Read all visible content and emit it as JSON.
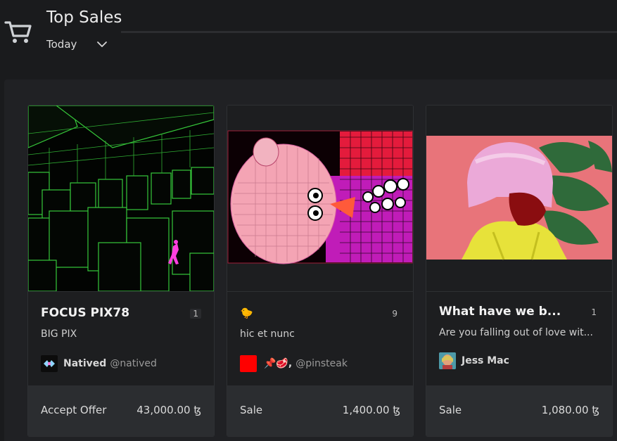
{
  "header": {
    "title": "Top Sales",
    "filter_label": "Today"
  },
  "cards": [
    {
      "title": "FOCUS PIX78",
      "edition": "1",
      "subtitle": "BIG PIX",
      "creator_name": "Natived",
      "creator_handle": "@natived",
      "sale_type": "Accept Offer",
      "price": "43,000.00 ꜩ"
    },
    {
      "title": "🐤",
      "edition": "9",
      "subtitle": "hic et nunc",
      "creator_name": "📌🥩,",
      "creator_handle": "@pinsteak",
      "sale_type": "Sale",
      "price": "1,400.00 ꜩ"
    },
    {
      "title": "What have we b...",
      "edition": "1",
      "subtitle": "Are you falling out of love wit...",
      "creator_name": "Jess Mac",
      "creator_handle": "",
      "sale_type": "Sale",
      "price": "1,080.00 ꜩ"
    }
  ],
  "colors": {
    "background": "#1a1b1d",
    "panel": "#202124",
    "card_footer": "#2b2d30",
    "grid_green": "#39d13a",
    "wig_pink": "#e9a6d6",
    "raincoat_yellow": "#e8e23a"
  }
}
